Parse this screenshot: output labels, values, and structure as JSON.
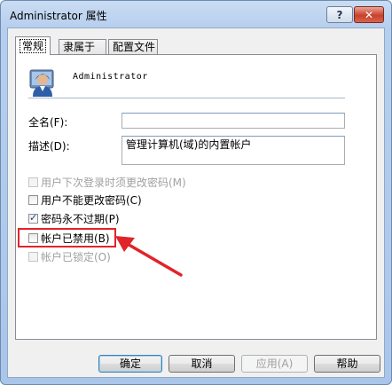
{
  "window": {
    "title": "Administrator 属性",
    "help": "?",
    "close": "✕"
  },
  "tabs": [
    {
      "label": "常规"
    },
    {
      "label": "隶属于"
    },
    {
      "label": "配置文件"
    }
  ],
  "general": {
    "username": "Administrator",
    "fullname_label": "全名(F):",
    "fullname_value": "",
    "description_label": "描述(D):",
    "description_value": "管理计算机(域)的内置帐户",
    "checkboxes": [
      {
        "label": "用户下次登录时须更改密码(M)",
        "checked": false,
        "disabled": true
      },
      {
        "label": "用户不能更改密码(C)",
        "checked": false,
        "disabled": false
      },
      {
        "label": "密码永不过期(P)",
        "checked": true,
        "disabled": false
      },
      {
        "label": "帐户已禁用(B)",
        "checked": false,
        "disabled": false
      },
      {
        "label": "帐户已锁定(O)",
        "checked": false,
        "disabled": true
      }
    ]
  },
  "buttons": {
    "ok": "确定",
    "cancel": "取消",
    "apply": "应用(A)",
    "help": "帮助"
  },
  "colors": {
    "highlight": "#e0242a"
  }
}
